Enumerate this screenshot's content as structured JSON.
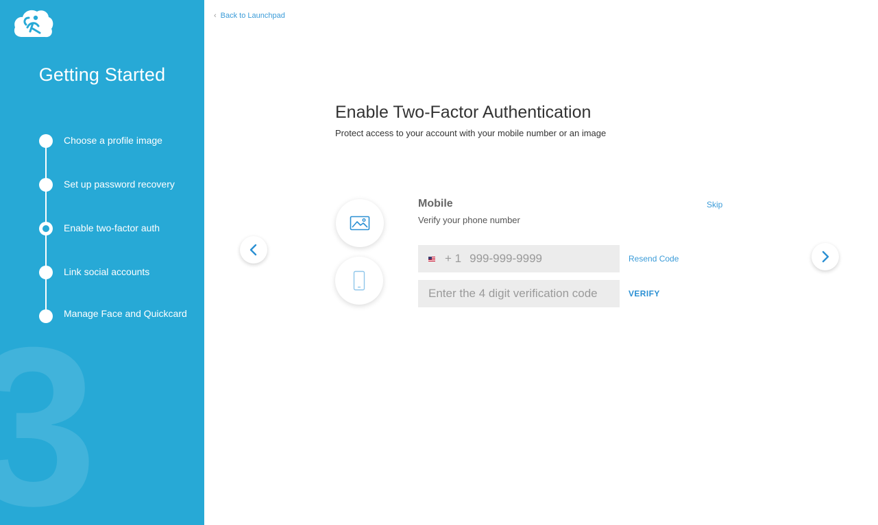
{
  "sidebar": {
    "logo": "cloud-figure-logo",
    "title": "Getting Started",
    "big_number": "3",
    "steps": [
      {
        "label": "Choose a profile image",
        "state": "done"
      },
      {
        "label": "Set up password recovery",
        "state": "done"
      },
      {
        "label": "Enable two-factor auth",
        "state": "active"
      },
      {
        "label": "Link social accounts",
        "state": "pending"
      },
      {
        "label": "Manage Face and Quickcard",
        "state": "pending"
      }
    ]
  },
  "header": {
    "back_label": "Back to Launchpad"
  },
  "main": {
    "title": "Enable Two-Factor Authentication",
    "subtitle": "Protect access to  your account  with your mobile number or an image",
    "methods": [
      {
        "icon": "image-icon",
        "name": "image"
      },
      {
        "icon": "mobile-phone-icon",
        "name": "mobile"
      }
    ],
    "mobile": {
      "title": "Mobile",
      "subtitle": "Verify  your phone number",
      "skip_label": "Skip",
      "country_flag": "us-flag-icon",
      "country_code": "+ 1",
      "phone_placeholder": "999-999-9999",
      "resend_label": "Resend Code",
      "code_placeholder": "Enter the 4 digit verification code",
      "verify_label": "VERIFY"
    }
  },
  "colors": {
    "sidebar_bg": "#27a9d6",
    "link": "#3a9bd8",
    "field_bg": "#ececec"
  }
}
